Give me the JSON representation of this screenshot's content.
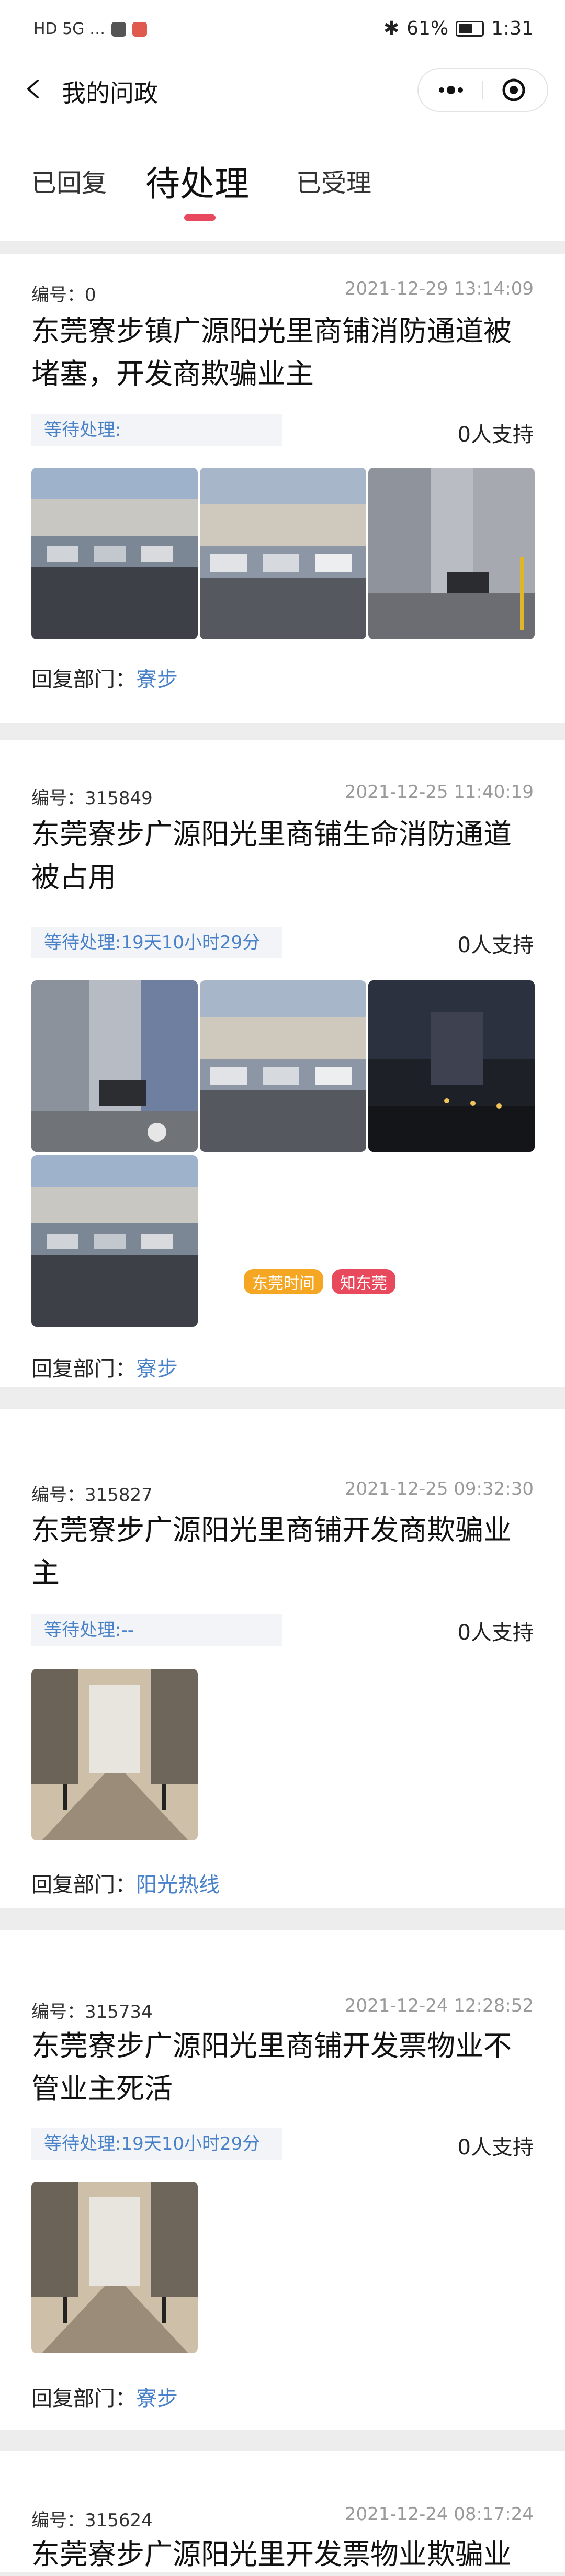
{
  "status_bar": {
    "left_text": "HD 5G …",
    "battery": "61%",
    "battery_level": 0.61,
    "time": "1:31"
  },
  "nav": {
    "title": "我的问政"
  },
  "tabs": [
    {
      "label": "已回复",
      "active": false
    },
    {
      "label": "待处理",
      "active": true
    },
    {
      "label": "已受理",
      "active": false
    }
  ],
  "colors": {
    "accent": "#e8495d",
    "link": "#4a82c9"
  },
  "labels": {
    "serial_prefix": "编号：",
    "reply_prefix": "回复部门："
  },
  "cards": [
    {
      "serial": "0",
      "time": "2021-12-29 13:14:09",
      "title": "东莞寮步镇广源阳光里商铺消防通道被堵塞，开发商欺骗业主",
      "status": "等待处理:",
      "support": "0人支持",
      "images": [
        "parking-lot-photo",
        "parking-lot-photo",
        "fire-lane-photo"
      ],
      "dept": "寮步"
    },
    {
      "serial": "315849",
      "time": "2021-12-25 11:40:19",
      "title": "东莞寮步广源阳光里商铺生命消防通道被占用",
      "status": "等待处理:19天10小时29分",
      "support": "0人支持",
      "images": [
        "fire-lane-photo",
        "parking-lot-photo",
        "night-photo",
        "parking-lot-photo"
      ],
      "dept": "寮步"
    },
    {
      "serial": "315827",
      "time": "2021-12-25 09:32:30",
      "title": "东莞寮步广源阳光里商铺开发商欺骗业主",
      "status": "等待处理:--",
      "support": "0人支持",
      "images": [
        "arcade-walkway-photo"
      ],
      "dept": "阳光热线"
    },
    {
      "serial": "315734",
      "time": "2021-12-24 12:28:52",
      "title": "东莞寮步广源阳光里商铺开发票物业不管业主死活",
      "status": "等待处理:19天10小时29分",
      "support": "0人支持",
      "images": [
        "arcade-walkway-photo"
      ],
      "dept": "寮步"
    },
    {
      "serial": "315624",
      "time": "2021-12-24 08:17:24",
      "title": "东莞寮步广源阳光里开发票物业欺骗业",
      "status": "",
      "support": "",
      "images": [],
      "dept": ""
    }
  ],
  "watermark": {
    "left": "东莞时间",
    "right": "知东莞"
  }
}
